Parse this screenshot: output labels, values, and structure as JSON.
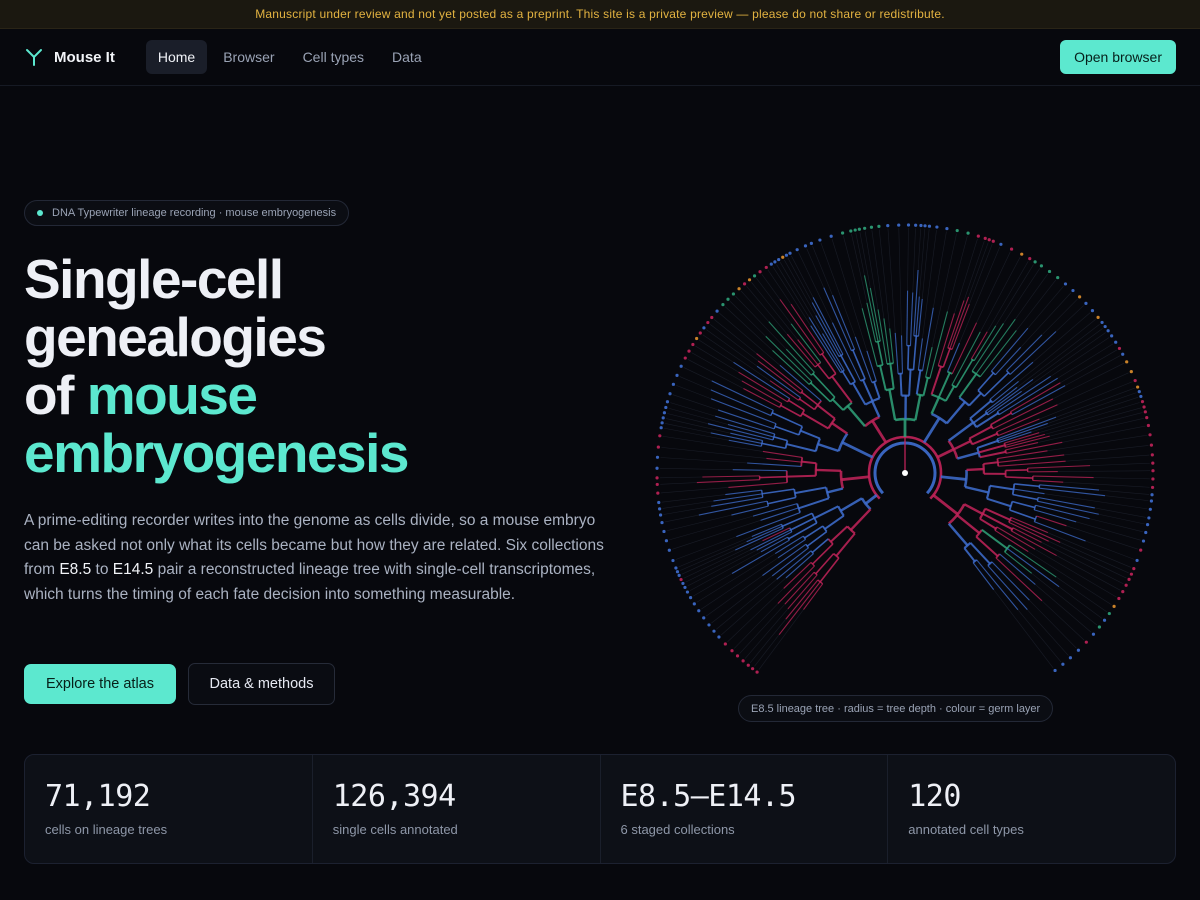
{
  "banner": {
    "text": "Manuscript under review and not yet posted as a preprint. This site is a private preview — please do not share or redistribute."
  },
  "nav": {
    "brand": "Mouse It",
    "logo_icon": "branching-y-icon",
    "links": [
      {
        "label": "Home",
        "active": true
      },
      {
        "label": "Browser",
        "active": false
      },
      {
        "label": "Cell types",
        "active": false
      },
      {
        "label": "Data",
        "active": false
      }
    ],
    "cta": "Open browser"
  },
  "hero": {
    "pill": "DNA Typewriter lineage recording · mouse embryogenesis",
    "headline_line1": "Single-cell",
    "headline_line2": "genealogies",
    "headline_of": "of",
    "headline_accent1": "mouse",
    "headline_accent2": "embryogenesis",
    "lede": {
      "p1": "A prime-editing recorder writes into the genome as cells divide, so a mouse embryo can be asked not only what its cells became but how they are related. Six collections from ",
      "start": "E8.5",
      "p2": " to ",
      "end": "E14.5",
      "p3": " pair a reconstructed lineage tree with single-cell transcriptomes, which turns the timing of each fate decision into something measurable."
    },
    "primary_button": "Explore the atlas",
    "secondary_button": "Data & methods"
  },
  "figure": {
    "caption": "E8.5 lineage tree · radius = tree depth · colour = germ layer",
    "colors": {
      "ectoderm": "#3f6fd1",
      "mesoderm": "#c2245a",
      "endoderm": "#2fa37a",
      "other": "#e0902c",
      "root": "#ffffff"
    }
  },
  "stats": [
    {
      "value": "71,192",
      "label": "cells on lineage trees"
    },
    {
      "value": "126,394",
      "label": "single cells annotated"
    },
    {
      "value": "E8.5–E14.5",
      "label": "6 staged collections"
    },
    {
      "value": "120",
      "label": "annotated cell types"
    }
  ],
  "accent_color": "#5ce8cf"
}
